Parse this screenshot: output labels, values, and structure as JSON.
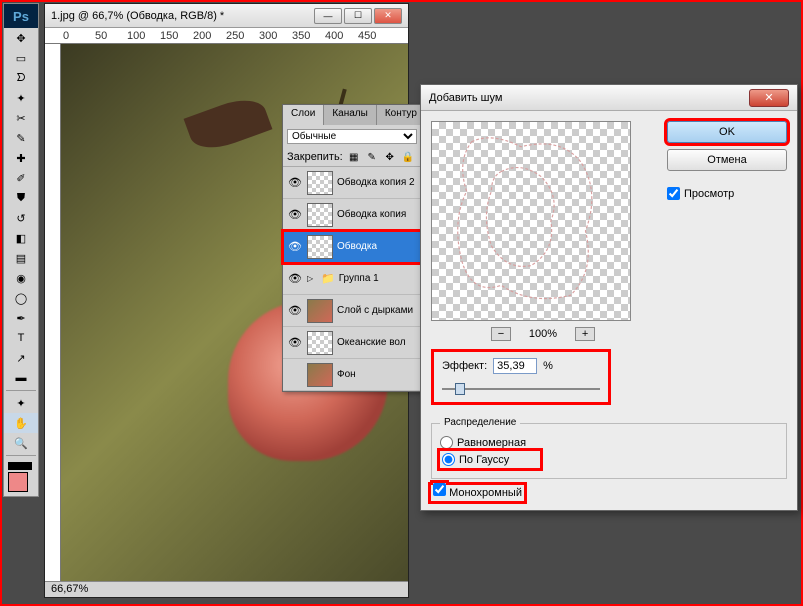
{
  "doc": {
    "title": "1.jpg @ 66,7% (Обводка, RGB/8) *",
    "zoom_status": "66,67%",
    "ruler_marks": [
      "0",
      "50",
      "100",
      "150",
      "200",
      "250",
      "300",
      "350",
      "400",
      "450"
    ]
  },
  "toolbox": {
    "tools": [
      "move",
      "marquee",
      "lasso",
      "wand",
      "crop",
      "eyedropper",
      "healing",
      "brush",
      "stamp",
      "history",
      "eraser",
      "gradient",
      "blur",
      "dodge",
      "pen",
      "type",
      "path",
      "shape",
      "3d",
      "hand",
      "zoom"
    ]
  },
  "layers": {
    "tabs": [
      "Слои",
      "Каналы",
      "Контур"
    ],
    "blend_mode": "Обычные",
    "lock_label": "Закрепить:",
    "items": [
      {
        "name": "Обводка копия 2",
        "vis": true
      },
      {
        "name": "Обводка копия",
        "vis": true
      },
      {
        "name": "Обводка",
        "vis": true,
        "selected": true
      },
      {
        "name": "Группа 1",
        "vis": true,
        "group": true
      },
      {
        "name": "Слой с дырками",
        "vis": true,
        "rose": true
      },
      {
        "name": "Океанские вол",
        "vis": true
      },
      {
        "name": "Фон",
        "vis": true,
        "rose": true
      }
    ]
  },
  "dialog": {
    "title": "Добавить шум",
    "ok": "OK",
    "cancel": "Отмена",
    "preview": "Просмотр",
    "zoom": "100%",
    "effect_label": "Эффект:",
    "effect_value": "35,39",
    "effect_unit": "%",
    "dist_label": "Распределение",
    "dist_uniform": "Равномерная",
    "dist_gauss": "По Гауссу",
    "mono": "Монохромный"
  }
}
